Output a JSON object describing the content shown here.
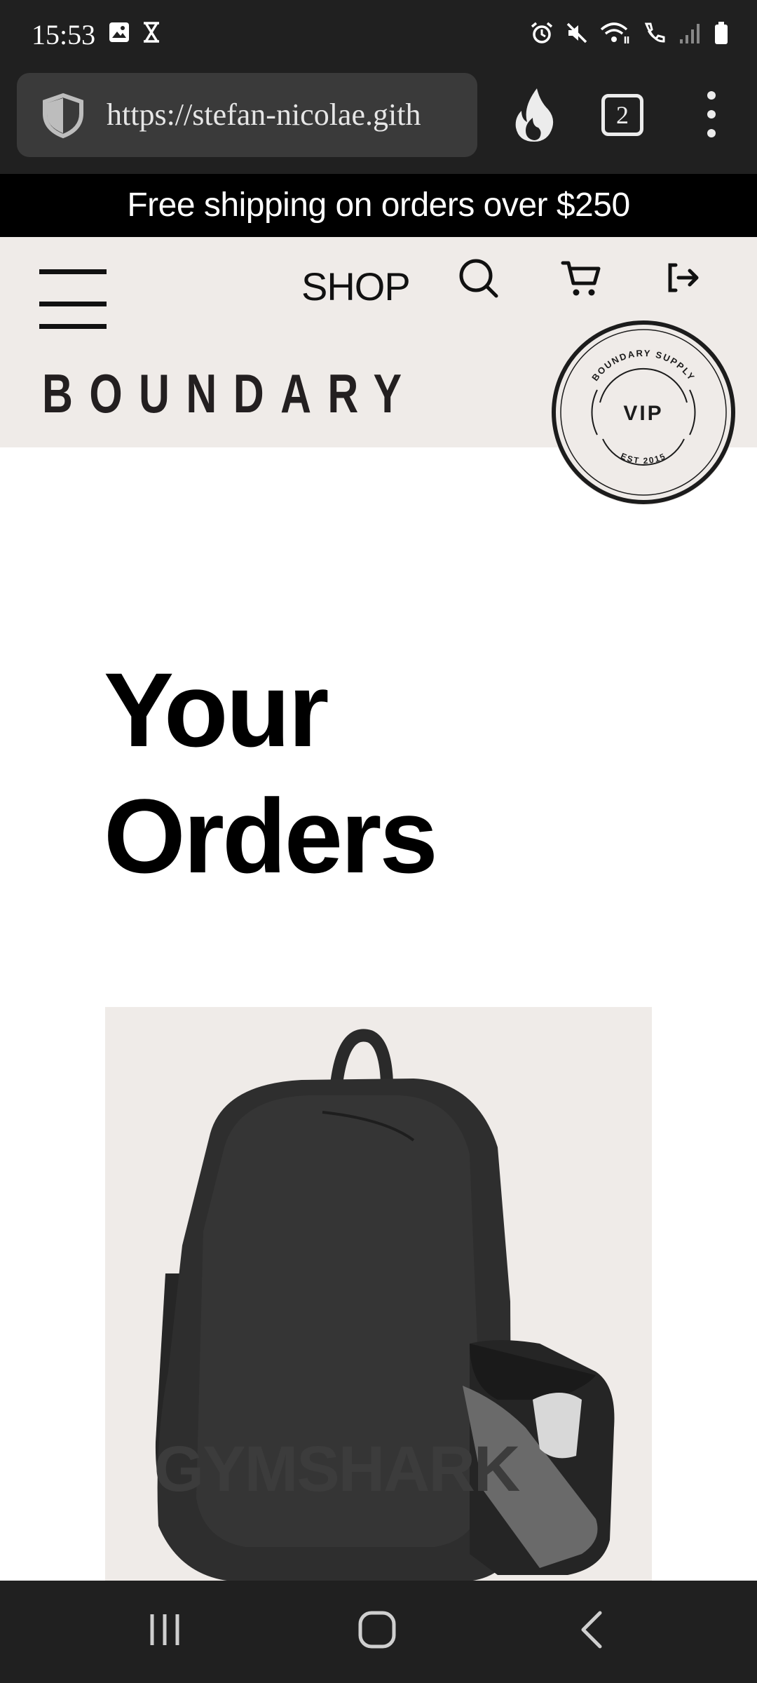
{
  "status_bar": {
    "time": "15:53",
    "icons": [
      "gallery-icon",
      "hourglass-icon",
      "alarm-icon",
      "mute-icon",
      "wifi-icon",
      "call-icon",
      "signal-icon",
      "battery-icon"
    ]
  },
  "browser": {
    "url": "https://stefan-nicolae.gith",
    "tab_count": "2"
  },
  "announcement": "Free shipping on orders over $250",
  "header": {
    "shop_label": "SHOP",
    "logo": "BOUNDARY",
    "badge": {
      "top_text": "BOUNDARY SUPPLY",
      "center_text": "VIP",
      "bottom_text": "EST 2015"
    }
  },
  "main": {
    "title": "Your Orders",
    "product_image": {
      "subject": "backpack",
      "brand_mark": "GYMSHARK",
      "background": "#efebe8"
    }
  },
  "colors": {
    "system_bar": "#202020",
    "announcement_bg": "#000000",
    "header_bg": "#efebe8",
    "text": "#111111"
  }
}
